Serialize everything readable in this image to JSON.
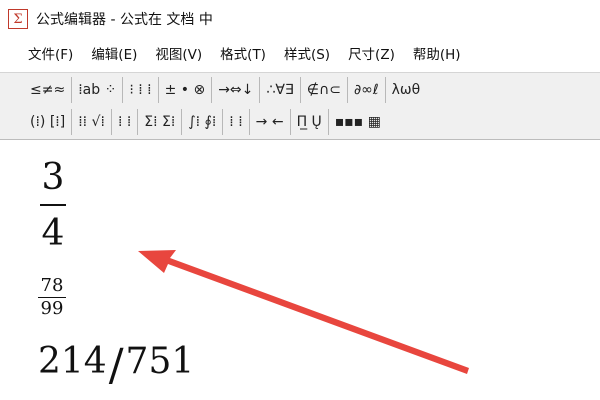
{
  "window": {
    "icon_glyph": "Σ",
    "title": "公式编辑器 - 公式在 文档 中"
  },
  "menu": [
    "文件(F)",
    "编辑(E)",
    "视图(V)",
    "格式(T)",
    "样式(S)",
    "尺寸(Z)",
    "帮助(H)"
  ],
  "toolbar": {
    "row1": [
      "≤≠≈",
      "⁞ab ⁘",
      "⁝ ⁞ ⁞",
      "± • ⊗",
      "→⇔↓",
      "∴∀∃",
      "∉∩⊂",
      "∂∞ℓ",
      "λωθ"
    ],
    "row2": [
      "(⁞) [⁞]",
      "⁞⁞ √⁞",
      "⁞ ⁞",
      "Σ⁞ Σ⁞",
      "∫⁞ ∮⁞",
      "⁞ ⁞",
      "→ ←",
      "Π̲ Ų",
      "▪▪▪ ▦"
    ]
  },
  "document": {
    "fraction1": {
      "numerator": "3",
      "denominator": "4"
    },
    "fraction2": {
      "numerator": "78",
      "denominator": "99"
    },
    "fraction3": {
      "numerator": "214",
      "slash": "/",
      "denominator": "751"
    }
  },
  "colors": {
    "arrow": "#e8463e",
    "icon": "#c0392b"
  }
}
